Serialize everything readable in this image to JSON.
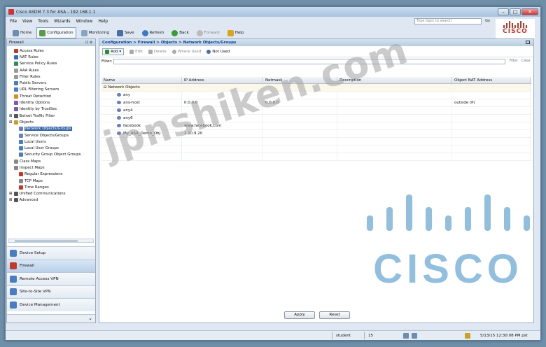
{
  "window": {
    "title": "Cisco ASDM 7.3 for ASA - 192.168.1.1"
  },
  "menu": [
    "File",
    "View",
    "Tools",
    "Wizards",
    "Window",
    "Help"
  ],
  "topsearch": {
    "placeholder": "Type topic to search",
    "go": "Go"
  },
  "toolbar": [
    "Home",
    "Configuration",
    "Monitoring",
    "Save",
    "Refresh",
    "Back",
    "Forward",
    "Help"
  ],
  "brand": {
    "logo_text": "CISCO",
    "accent": "#c0392b"
  },
  "leftpane": {
    "title": "Firewall",
    "tree": [
      {
        "label": "Access Rules",
        "level": 1,
        "color": "#c0392b"
      },
      {
        "label": "NAT Rules",
        "level": 1,
        "color": "#2e6fc2"
      },
      {
        "label": "Service Policy Rules",
        "level": 1,
        "color": "#2e8b57"
      },
      {
        "label": "AAA Rules",
        "level": 1,
        "color": "#999"
      },
      {
        "label": "Filter Rules",
        "level": 1,
        "color": "#999"
      },
      {
        "label": "Public Servers",
        "level": 1,
        "color": "#4a7dbf"
      },
      {
        "label": "URL Filtering Servers",
        "level": 1,
        "color": "#4a7dbf"
      },
      {
        "label": "Threat Detection",
        "level": 1,
        "color": "#d98c1a"
      },
      {
        "label": "Identity Options",
        "level": 1,
        "color": "#7a5ca8"
      },
      {
        "label": "Identity by TrustSec",
        "level": 1,
        "color": "#7a5ca8"
      },
      {
        "label": "Botnet Traffic Filter",
        "level": 0,
        "color": "#555"
      },
      {
        "label": "Objects",
        "level": 0,
        "color": "#c89b2a"
      },
      {
        "label": "Network Objects/Groups",
        "level": 2,
        "color": "#6b7fc4",
        "selected": true
      },
      {
        "label": "Service Objects/Groups",
        "level": 2,
        "color": "#6b7fc4"
      },
      {
        "label": "Local Users",
        "level": 2,
        "color": "#4a7dbf"
      },
      {
        "label": "Local User Groups",
        "level": 2,
        "color": "#4a7dbf"
      },
      {
        "label": "Security Group Object Groups",
        "level": 2,
        "color": "#4a7dbf"
      },
      {
        "label": "Class Maps",
        "level": 1,
        "color": "#888"
      },
      {
        "label": "Inspect Maps",
        "level": 1,
        "color": "#888"
      },
      {
        "label": "Regular Expressions",
        "level": 2,
        "color": "#c0392b"
      },
      {
        "label": "TCP Maps",
        "level": 2,
        "color": "#888"
      },
      {
        "label": "Time Ranges",
        "level": 2,
        "color": "#c0392b"
      },
      {
        "label": "Unified Communications",
        "level": 0,
        "color": "#555"
      },
      {
        "label": "Advanced",
        "level": 0,
        "color": "#555"
      }
    ],
    "nav": [
      {
        "label": "Device Setup",
        "color": "#4a7dbf"
      },
      {
        "label": "Firewall",
        "color": "#c0392b",
        "active": true
      },
      {
        "label": "Remote Access VPN",
        "color": "#4a7dbf"
      },
      {
        "label": "Site-to-Site VPN",
        "color": "#4a7dbf"
      },
      {
        "label": "Device Management",
        "color": "#4a7dbf"
      }
    ]
  },
  "main": {
    "breadcrumb": "Configuration > Firewall > Objects > Network Objects/Groups",
    "actions": {
      "add": "Add",
      "edit": "Edit",
      "delete": "Delete",
      "where_used": "Where Used",
      "not_used": "Not Used"
    },
    "filter": {
      "label": "Filter:",
      "filter_btn": "Filter",
      "clear_btn": "Clear"
    },
    "columns": [
      "Name",
      "IP Address",
      "Netmask",
      "Description",
      "Object NAT Address"
    ],
    "group_label": "Network Objects",
    "rows": [
      {
        "name": "any",
        "ip": "",
        "mask": "",
        "desc": "",
        "nat": ""
      },
      {
        "name": "any-host",
        "ip": "0.0.0.0",
        "mask": "0.0.0.0",
        "desc": "",
        "nat": "outside (P)"
      },
      {
        "name": "any4",
        "ip": "",
        "mask": "",
        "desc": "",
        "nat": ""
      },
      {
        "name": "any6",
        "ip": "",
        "mask": "",
        "desc": "",
        "nat": ""
      },
      {
        "name": "facebook",
        "ip": "www.facebook.com",
        "mask": "",
        "desc": "",
        "nat": ""
      },
      {
        "name": "My_ASA_Demo_Obj",
        "ip": "1.10.9.20",
        "mask": "",
        "desc": "",
        "nat": ""
      }
    ],
    "apply": "Apply",
    "reset": "Reset"
  },
  "status": {
    "user": "student",
    "count": "15",
    "datetime": "5/13/15 12:30:08 PM pst"
  },
  "watermark": {
    "text": "jpnshiken.com",
    "logo_text": "CISCO",
    "color": "#7fb4d8"
  }
}
